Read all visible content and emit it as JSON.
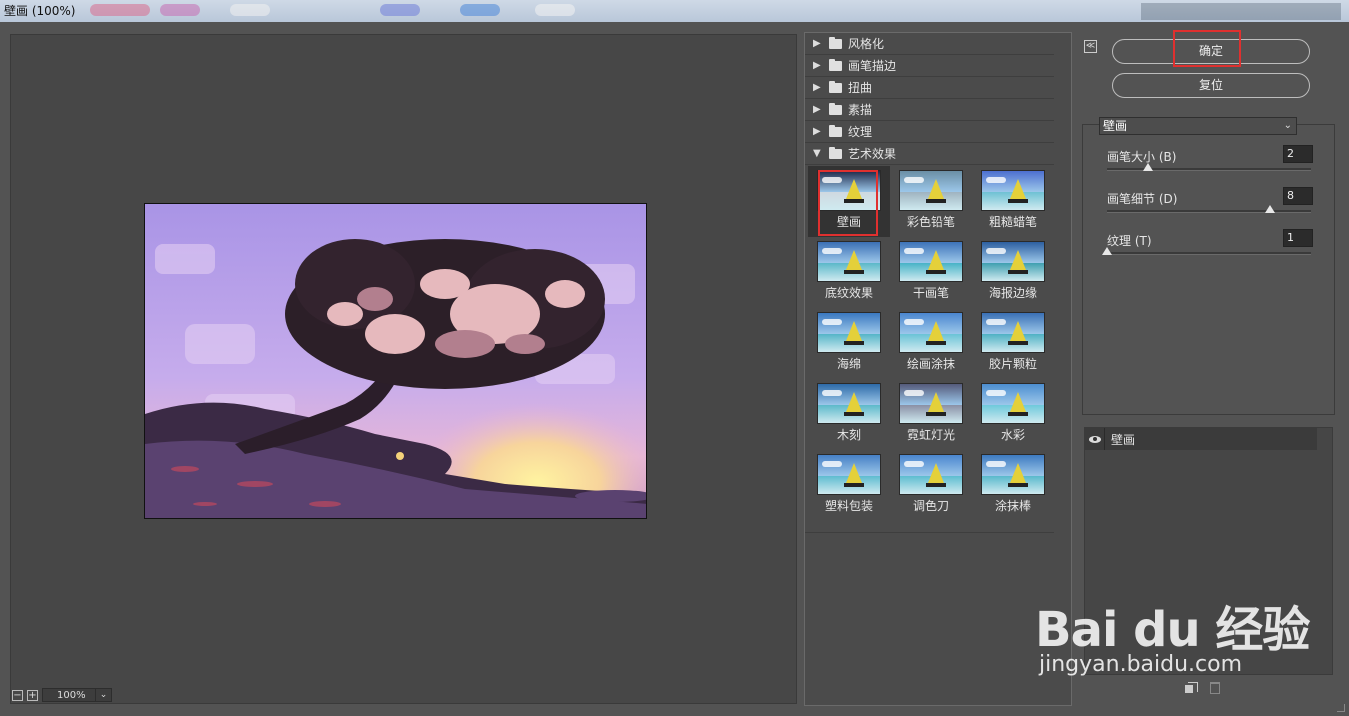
{
  "window": {
    "title": "壁画 (100%)"
  },
  "preview": {
    "zoom": "100%",
    "zoom_out": "−",
    "zoom_in": "+"
  },
  "gallery": {
    "categories": [
      {
        "label": "风格化",
        "expanded": false
      },
      {
        "label": "画笔描边",
        "expanded": false
      },
      {
        "label": "扭曲",
        "expanded": false
      },
      {
        "label": "素描",
        "expanded": false
      },
      {
        "label": "纹理",
        "expanded": false
      },
      {
        "label": "艺术效果",
        "expanded": true
      }
    ],
    "collapsed_marker": "▶",
    "expanded_marker": "▼",
    "filters": [
      "壁画",
      "彩色铅笔",
      "粗糙蜡笔",
      "底纹效果",
      "干画笔",
      "海报边缘",
      "海绵",
      "绘画涂抹",
      "胶片颗粒",
      "木刻",
      "霓虹灯光",
      "水彩",
      "塑料包装",
      "调色刀",
      "涂抹棒"
    ],
    "selected_filter": "壁画"
  },
  "buttons": {
    "ok": "确定",
    "reset": "复位",
    "collapse": "≪"
  },
  "settings": {
    "filter_name": "壁画",
    "params": [
      {
        "label": "画笔大小 (B)",
        "value": "2",
        "level": 0.2
      },
      {
        "label": "画笔细节 (D)",
        "value": "8",
        "level": 0.8
      },
      {
        "label": "纹理 (T)",
        "value": "1",
        "level": 0.0
      }
    ]
  },
  "layers": {
    "items": [
      {
        "label": "壁画",
        "visible": true
      }
    ]
  },
  "watermark": {
    "brand": "Bai du 经验",
    "url": "jingyan.baidu.com"
  },
  "colors": {
    "highlight": "#e0302f",
    "panel": "#535353"
  }
}
